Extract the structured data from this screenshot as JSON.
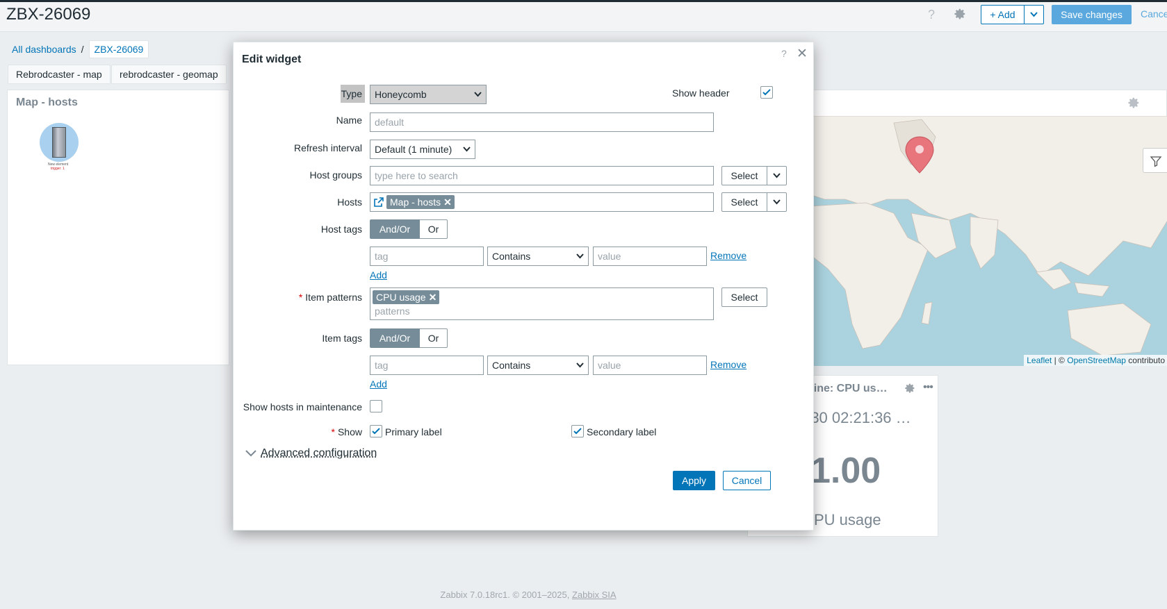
{
  "header": {
    "title": "ZBX-26069",
    "add_label": "+ Add",
    "save_label": "Save changes",
    "cancel_label": "Cance"
  },
  "breadcrumb": {
    "all_dashboards": "All dashboards",
    "separator": "/",
    "current": "ZBX-26069"
  },
  "dashboard_tabs": [
    "Rebrodcaster - map",
    "rebrodcaster - geomap"
  ],
  "widget_map_hosts": {
    "title": "Map - hosts",
    "element_label": "New element",
    "element_trigger": "trigger: 1"
  },
  "widget_geomap": {
    "attribution_leaflet": "Leaflet",
    "attribution_sep": " | © ",
    "attribution_osm": "OpenStreetMap",
    "attribution_tail": " contributo"
  },
  "widget_cpu": {
    "title": "hine: CPU us…",
    "time": "-30 02:21:36 …",
    "value": "1.00",
    "label": "PU usage"
  },
  "footer": {
    "text": "Zabbix 7.0.18rc1. © 2001–2025, ",
    "link": "Zabbix SIA"
  },
  "modal": {
    "title": "Edit widget",
    "help": "?",
    "close": "✕",
    "type_label": "Type",
    "type_value": "Honeycomb",
    "show_header_label": "Show header",
    "show_header_checked": true,
    "name_label": "Name",
    "name_placeholder": "default",
    "refresh_label": "Refresh interval",
    "refresh_value": "Default (1 minute)",
    "host_groups_label": "Host groups",
    "host_groups_placeholder": "type here to search",
    "hosts_label": "Hosts",
    "hosts_chip": "Map - hosts",
    "select_label": "Select",
    "host_tags_label": "Host tags",
    "andor_label": "And/Or",
    "or_label": "Or",
    "tag_placeholder": "tag",
    "operator_value": "Contains",
    "value_placeholder": "value",
    "remove_label": "Remove",
    "add_label": "Add",
    "item_patterns_label": "Item patterns",
    "item_patterns_chip": "CPU usage",
    "patterns_placeholder": "patterns",
    "item_tags_label": "Item tags",
    "show_maintenance_label": "Show hosts in maintenance",
    "show_label": "Show",
    "primary_label": "Primary label",
    "secondary_label": "Secondary label",
    "advanced_label": "Advanced configuration",
    "apply_label": "Apply",
    "cancel_label": "Cancel"
  }
}
